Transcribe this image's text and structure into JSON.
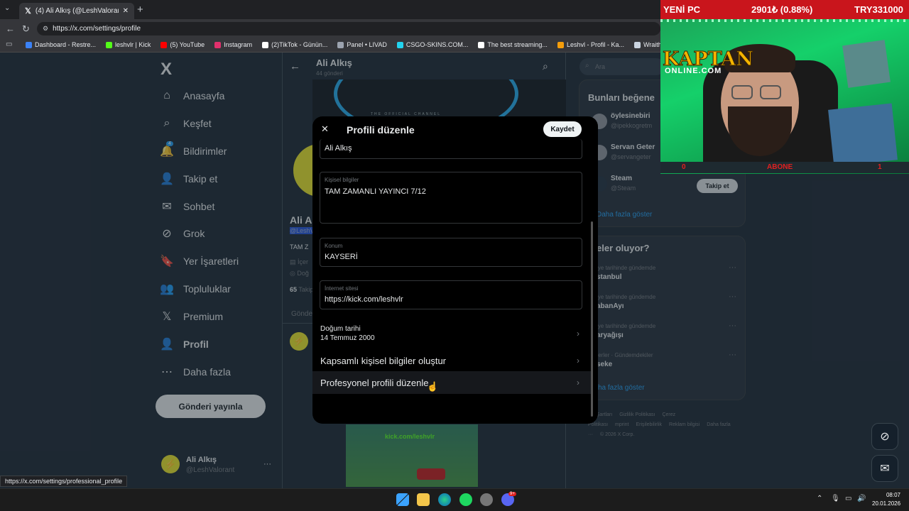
{
  "browser": {
    "tab_title": "(4) Ali Alkış (@LeshValorant) adlı k",
    "tab_close": "✕",
    "new_tab": "+",
    "url": "https://x.com/settings/profile",
    "bookmarks": [
      {
        "label": "Dashboard - Restre...",
        "color": "#3b82f6"
      },
      {
        "label": "leshvlr | Kick",
        "color": "#53fc18"
      },
      {
        "label": "(5) YouTube",
        "color": "#ff0000"
      },
      {
        "label": "Instagram",
        "color": "#e1306c"
      },
      {
        "label": "(2)TikTok - Günün...",
        "color": "#ffffff"
      },
      {
        "label": "Panel • LIVAD",
        "color": "#9ca3af"
      },
      {
        "label": "CSGO-SKINS.COM...",
        "color": "#22d3ee"
      },
      {
        "label": "The best streaming...",
        "color": "#ffffff"
      },
      {
        "label": "Leshvl - Profil - Ka...",
        "color": "#f59e0b"
      },
      {
        "label": "Wraith",
        "color": "#cbd5e1"
      },
      {
        "label": "LeshVL",
        "color": "#a855f7"
      }
    ],
    "status_url": "https://x.com/settings/professional_profile"
  },
  "sidebar": {
    "logo": "X",
    "items": [
      {
        "label": "Anasayfa",
        "icon": "home-icon",
        "glyph": "⌂"
      },
      {
        "label": "Keşfet",
        "icon": "search-icon",
        "glyph": "⌕"
      },
      {
        "label": "Bildirimler",
        "icon": "bell-icon",
        "glyph": "🔔",
        "badge": "4"
      },
      {
        "label": "Takip et",
        "icon": "person-add-icon",
        "glyph": "👤"
      },
      {
        "label": "Sohbet",
        "icon": "mail-icon",
        "glyph": "✉"
      },
      {
        "label": "Grok",
        "icon": "grok-icon",
        "glyph": "⊘"
      },
      {
        "label": "Yer İşaretleri",
        "icon": "bookmark-icon",
        "glyph": "🔖"
      },
      {
        "label": "Topluluklar",
        "icon": "communities-icon",
        "glyph": "👥"
      },
      {
        "label": "Premium",
        "icon": "x-premium-icon",
        "glyph": "𝕏"
      },
      {
        "label": "Profil",
        "icon": "profile-icon",
        "glyph": "👤"
      },
      {
        "label": "Daha fazla",
        "icon": "more-circle-icon",
        "glyph": "⋯"
      }
    ],
    "post_button": "Gönderi yayınla",
    "account": {
      "name": "Ali Alkış",
      "handle": "@LeshValorant",
      "menu": "···"
    }
  },
  "profile_header": {
    "back": "←",
    "name": "Ali Alkış",
    "posts": "44 gönderi",
    "banner_text": "THE OFFICIAL CHANNEL",
    "partial_name": "Ali A",
    "partial_handle": "@LeshV",
    "partial_bio": "TAM Z",
    "partial_cat": "İçer",
    "partial_loc": "Doğ",
    "following_count": "65",
    "following_label": "Takip",
    "tab_posts": "Gönde",
    "video_caption": "kick.com/leshvlr"
  },
  "modal": {
    "close": "✕",
    "title": "Profili düzenle",
    "save": "Kaydet",
    "name_value": "Ali Alkış",
    "bio_label": "Kişisel bilgiler",
    "bio_value": "TAM ZAMANLI YAYINCI 7/12",
    "location_label": "Konum",
    "location_value": "KAYSERİ",
    "website_label": "İnternet sitesi",
    "website_value": "https://kick.com/leshvlr",
    "birth_label": "Doğum tarihi",
    "birth_value": "14 Temmuz 2000",
    "extended_bio": "Kapsamlı kişisel bilgiler oluştur",
    "professional": "Profesyonel profili düzenle",
    "chevron": "›"
  },
  "right": {
    "search_placeholder": "Ara",
    "who_to_follow_title": "Bunları beğene",
    "people": [
      {
        "name": "öylesinebiri",
        "handle": "@ipekkogretm"
      },
      {
        "name": "Servan Geter",
        "handle": "@servangeter"
      },
      {
        "name": "Steam",
        "handle": "@Steam",
        "follow": "Takip et"
      }
    ],
    "show_more": "Daha fazla göster",
    "trends_title": "eler oluyor?",
    "trends": [
      {
        "meta": "iye tarihinde gündemde",
        "topic": "stanbul"
      },
      {
        "meta": "iye tarihinde gündemde",
        "topic": "abanAyı"
      },
      {
        "meta": "iye tarihinde gündemde",
        "topic": "aryağışı"
      },
      {
        "meta": "ıerler · Gündemdekiler",
        "topic": "seke"
      }
    ],
    "trends_more": "ha fazla göster",
    "footer": [
      "nat Şartları",
      "Gizlilik Politikası",
      "Çerez Politikası",
      "mprint",
      "Erişilebilirlik",
      "Reklam bilgisi",
      "Daha fazla ···",
      "© 2026 X Corp."
    ]
  },
  "overlay": {
    "left_text": "YENİ PC",
    "mid_text": "2901₺ (0.88%)",
    "right_text": "TRY331000",
    "brand_top": "KAPTAN",
    "brand_bottom": "ONLINE.COM",
    "sub_left": "0",
    "sub_mid": "ABONE",
    "sub_right": "1"
  },
  "taskbar": {
    "time": "08:07",
    "date": "20.01.2026",
    "badge": "9+"
  }
}
